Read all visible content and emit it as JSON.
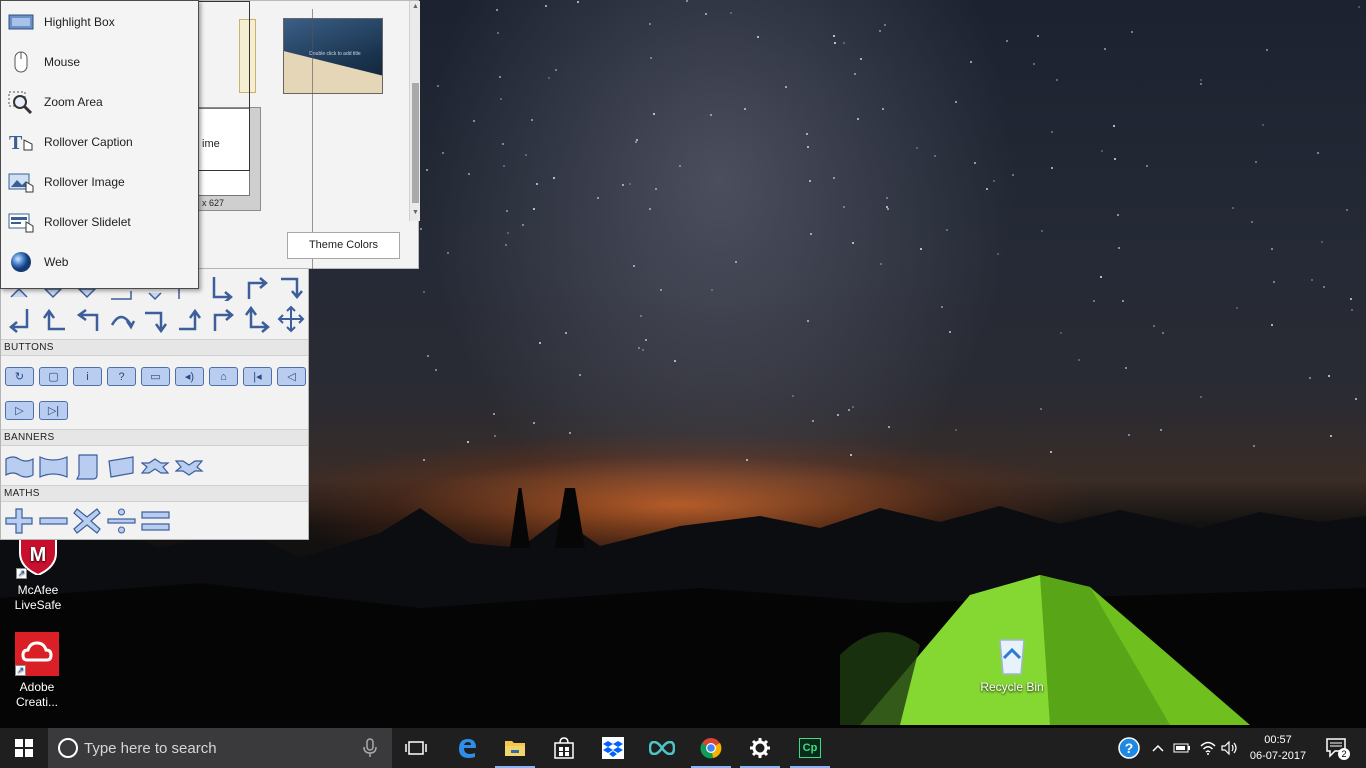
{
  "menu": {
    "items": [
      {
        "label": "Highlight Box",
        "icon": "highlight-box-icon"
      },
      {
        "label": "Mouse",
        "icon": "mouse-icon"
      },
      {
        "label": "Zoom Area",
        "icon": "zoom-area-icon"
      },
      {
        "label": "Rollover Caption",
        "icon": "rollover-caption-icon"
      },
      {
        "label": "Rollover Image",
        "icon": "rollover-image-icon"
      },
      {
        "label": "Rollover Slidelet",
        "icon": "rollover-slidelet-icon"
      },
      {
        "label": "Web",
        "icon": "web-globe-icon"
      }
    ]
  },
  "slide_panel": {
    "thumb_time_label": "ime",
    "thumb_size_label": "x 627",
    "slide_thumb_title": "Double click to add title",
    "theme_colors_button": "Theme Colors"
  },
  "shapes_panel": {
    "sections": {
      "buttons": "BUTTONS",
      "banners": "BANNERS",
      "maths": "MATHS"
    },
    "button_glyphs": [
      "↻",
      "▢",
      "i",
      "?",
      "▭",
      "◂)",
      "⌂",
      "|◂",
      "◁",
      "▷",
      "▷|"
    ]
  },
  "desktop": {
    "icons": [
      {
        "label": "McAfee LiveSafe",
        "icon": "mcafee-icon"
      },
      {
        "label": "Adobe Creati...",
        "icon": "adobe-creative-cloud-icon"
      },
      {
        "label": "Recycle Bin",
        "icon": "recycle-bin-icon"
      }
    ]
  },
  "taskbar": {
    "search_placeholder": "Type here to search",
    "apps": [
      "task-view-icon",
      "edge-icon",
      "file-explorer-icon",
      "store-icon",
      "dropbox-icon",
      "infinity-app-icon",
      "chrome-icon",
      "settings-icon",
      "captivate-icon"
    ],
    "captivate_label": "Cp",
    "clock_time": "00:57",
    "clock_date": "06-07-2017",
    "notification_count": "2"
  },
  "colors": {
    "taskbar_bg": "#1f1f20",
    "search_bg": "#3a3a3c",
    "button_shape_fill": "#b8cdef",
    "tent_green": "#7ed321"
  }
}
